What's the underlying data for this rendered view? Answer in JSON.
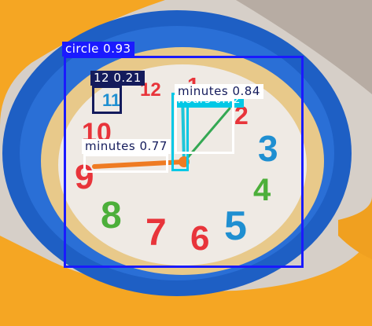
{
  "detections": [
    {
      "id": "circle",
      "label": "circle",
      "score": "0.93",
      "color": "#1a1aff",
      "text_color": "#ffffff"
    },
    {
      "id": "twelve",
      "label": "12",
      "score": "0.21",
      "color": "#141b5c",
      "text_color": "#ffffff"
    },
    {
      "id": "hours",
      "label": "hours",
      "score": "0.72",
      "color": "#00c8e6",
      "text_color": "#ffffff"
    },
    {
      "id": "minutes-a",
      "label": "minutes",
      "score": "0.84",
      "color": "#ffffff",
      "text_color": "#141b5c"
    },
    {
      "id": "minutes-b",
      "label": "minutes",
      "score": "0.77",
      "color": "#ffffff",
      "text_color": "#141b5c"
    }
  ],
  "dial_numbers": [
    "11",
    "12",
    "1",
    "2",
    "3",
    "4",
    "5",
    "6",
    "7",
    "8",
    "9",
    "10"
  ],
  "colors": {
    "strap_orange": "#f5a623",
    "bezel_blue": "#1e5fc4",
    "dial_white": "#efeae4",
    "num_red": "#e8343a",
    "num_blue": "#1f8fd1",
    "num_green": "#4caf3a",
    "hand_orange": "#ef7b22",
    "hand_green": "#34a853",
    "hand_cyan": "#20c6d8"
  }
}
